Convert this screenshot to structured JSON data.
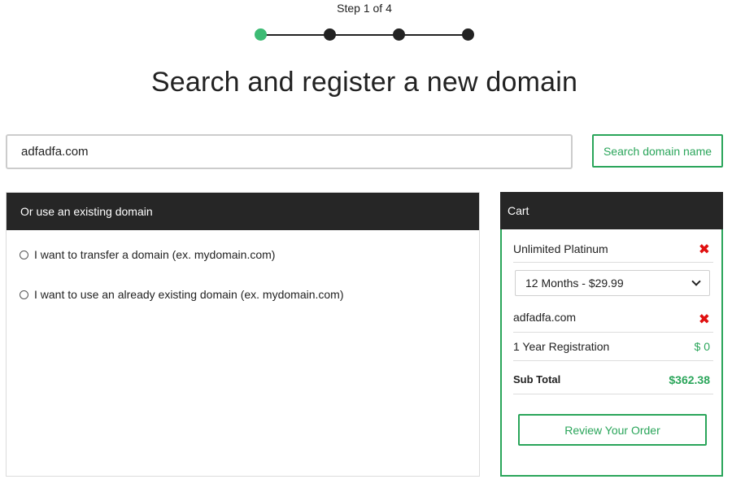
{
  "progress": {
    "label": "Step 1 of 4",
    "current_step": 1,
    "total_steps": 4,
    "active_color": "#3dbb74",
    "inactive_color": "#222222"
  },
  "page": {
    "title": "Search and register a new domain"
  },
  "search": {
    "value": "adfadfa.com",
    "button_label": "Search domain name"
  },
  "existing_domain": {
    "header": "Or use an existing domain",
    "options": [
      {
        "label": "I want to transfer a domain (ex. mydomain.com)",
        "selected": false
      },
      {
        "label": "I want to use an already existing domain (ex. mydomain.com)",
        "selected": false
      }
    ]
  },
  "cart": {
    "header": "Cart",
    "plan_name": "Unlimited Platinum",
    "term_selected": "12 Months - $29.99",
    "domain_name": "adfadfa.com",
    "registration_label": "1 Year Registration",
    "registration_price": "$ 0",
    "subtotal_label": "Sub Total",
    "subtotal_value": "$362.38",
    "review_button": "Review Your Order",
    "remove_icon": "x-icon"
  },
  "colors": {
    "accent": "#2aa55a",
    "header_bg": "#262626",
    "remove": "#e01010"
  }
}
